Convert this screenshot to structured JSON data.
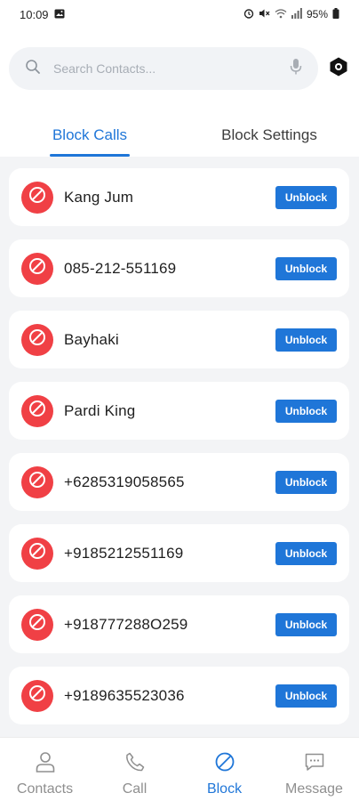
{
  "status_bar": {
    "time": "10:09",
    "battery": "95%",
    "icons": [
      "gallery-icon",
      "alarm-icon",
      "mute-icon",
      "wifi-icon",
      "signal-icon",
      "battery-icon"
    ]
  },
  "search": {
    "placeholder": "Search Contacts...",
    "icons": [
      "search-icon",
      "mic-icon"
    ]
  },
  "header": {
    "settings_icon": "gear-icon"
  },
  "tabs": [
    {
      "label": "Block Calls",
      "active": true
    },
    {
      "label": "Block Settings",
      "active": false
    }
  ],
  "blocked": [
    {
      "name": "Kang Jum",
      "action": "Unblock"
    },
    {
      "name": "085-212-551169",
      "action": "Unblock"
    },
    {
      "name": "Bayhaki",
      "action": "Unblock"
    },
    {
      "name": "Pardi King",
      "action": "Unblock"
    },
    {
      "name": "+6285319058565",
      "action": "Unblock"
    },
    {
      "name": "+9185212551169",
      "action": "Unblock"
    },
    {
      "name": "+918777288O259",
      "action": "Unblock"
    },
    {
      "name": "+9189635523036",
      "action": "Unblock"
    }
  ],
  "bottom_nav": [
    {
      "label": "Contacts",
      "icon": "person-icon",
      "active": false
    },
    {
      "label": "Call",
      "icon": "phone-icon",
      "active": false
    },
    {
      "label": "Block",
      "icon": "block-icon",
      "active": true
    },
    {
      "label": "Message",
      "icon": "message-icon",
      "active": false
    }
  ],
  "colors": {
    "accent": "#1f76d8",
    "danger": "#f04045",
    "list_bg": "#f3f4f6"
  }
}
